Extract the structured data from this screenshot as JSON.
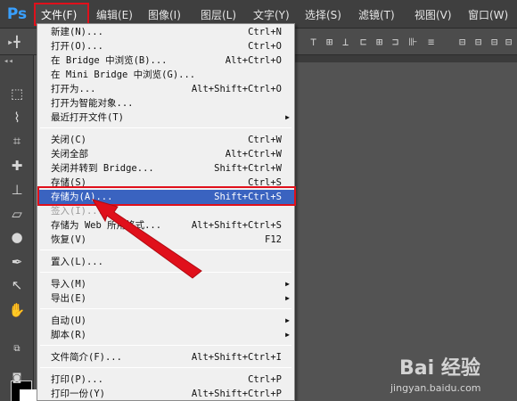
{
  "app": {
    "logo": "Ps"
  },
  "menubar": {
    "file": "文件(F)",
    "edit": "编辑(E)",
    "image": "图像(I)",
    "layer": "图层(L)",
    "type": "文字(Y)",
    "select": "选择(S)",
    "filter": "滤镜(T)",
    "view": "视图(V)",
    "window": "窗口(W)"
  },
  "file_menu": {
    "items": [
      {
        "label": "新建(N)...",
        "shortcut": "Ctrl+N"
      },
      {
        "label": "打开(O)...",
        "shortcut": "Ctrl+O"
      },
      {
        "label": "在 Bridge 中浏览(B)...",
        "shortcut": "Alt+Ctrl+O"
      },
      {
        "label": "在 Mini Bridge 中浏览(G)...",
        "shortcut": ""
      },
      {
        "label": "打开为...",
        "shortcut": "Alt+Shift+Ctrl+O"
      },
      {
        "label": "打开为智能对象...",
        "shortcut": ""
      },
      {
        "label": "最近打开文件(T)",
        "shortcut": ""
      },
      {
        "label": "关闭(C)",
        "shortcut": "Ctrl+W"
      },
      {
        "label": "关闭全部",
        "shortcut": "Alt+Ctrl+W"
      },
      {
        "label": "关闭并转到 Bridge...",
        "shortcut": "Shift+Ctrl+W"
      },
      {
        "label": "存储(S)",
        "shortcut": "Ctrl+S"
      },
      {
        "label": "存储为(A)...",
        "shortcut": "Shift+Ctrl+S"
      },
      {
        "label": "签入(I)...",
        "shortcut": ""
      },
      {
        "label": "存储为 Web 所用格式...",
        "shortcut": "Alt+Shift+Ctrl+S"
      },
      {
        "label": "恢复(V)",
        "shortcut": "F12"
      },
      {
        "label": "置入(L)...",
        "shortcut": ""
      },
      {
        "label": "导入(M)",
        "shortcut": ""
      },
      {
        "label": "导出(E)",
        "shortcut": ""
      },
      {
        "label": "自动(U)",
        "shortcut": ""
      },
      {
        "label": "脚本(R)",
        "shortcut": ""
      },
      {
        "label": "文件简介(F)...",
        "shortcut": "Alt+Shift+Ctrl+I"
      },
      {
        "label": "打印(P)...",
        "shortcut": "Ctrl+P"
      },
      {
        "label": "打印一份(Y)",
        "shortcut": "Alt+Shift+Ctrl+P"
      }
    ]
  },
  "watermark": {
    "logo": "Bai 经验",
    "url": "jingyan.baidu.com"
  },
  "colors": {
    "highlight": "#3a63c0",
    "annotation_red": "#e0101b",
    "ps_blue": "#39a0ff"
  }
}
